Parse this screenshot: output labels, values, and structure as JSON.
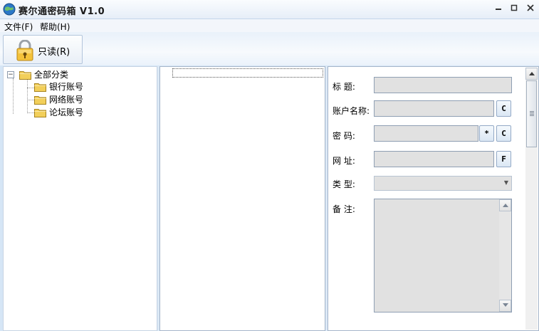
{
  "window": {
    "title": "赛尔通密码箱 V1.0",
    "minimize_glyph": "—",
    "restore_glyph": "▫",
    "close_glyph": "✕"
  },
  "menu": {
    "file": "文件(F)",
    "help": "帮助(H)"
  },
  "toolbar": {
    "readonly_label": "只读(R)"
  },
  "tree": {
    "root": {
      "expander": "⊟",
      "label": "全部分类"
    },
    "children": [
      {
        "label": "银行账号"
      },
      {
        "label": "网络账号"
      },
      {
        "label": "论坛账号"
      }
    ]
  },
  "details": {
    "title_label": "标    题:",
    "account_label": "账户名称:",
    "password_label": "密    码:",
    "url_label": "网    址:",
    "type_label": "类    型:",
    "notes_label": "备    注:",
    "title_value": "",
    "account_value": "",
    "password_value": "",
    "url_value": "",
    "type_value": "",
    "notes_value": "",
    "copy_account_btn": "C",
    "show_password_btn": "*",
    "copy_password_btn": "C",
    "open_url_btn": "F"
  },
  "colors": {
    "window_bg": "#d6e6f6",
    "field_bg": "#e1e1e1",
    "folder_yellow": "#f2cf5a"
  }
}
